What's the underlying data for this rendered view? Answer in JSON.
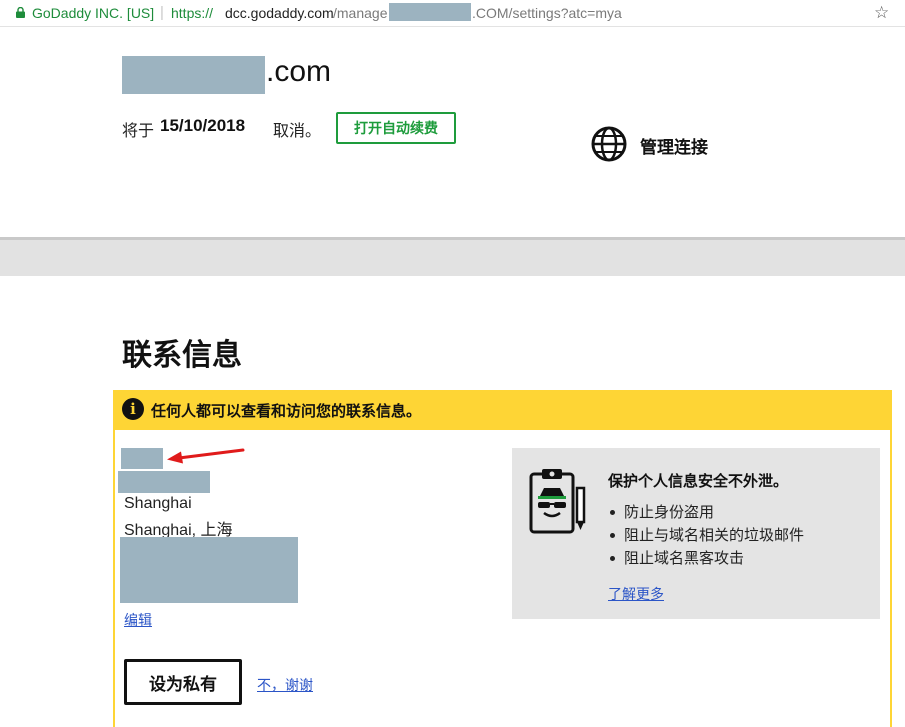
{
  "browser": {
    "secure_label": "GoDaddy INC. [US]",
    "separator": "|",
    "url_scheme": "https://",
    "url_host": "dcc.godaddy.com",
    "url_path_before": "/manage",
    "url_path_after": ".COM/settings?atc=mya",
    "bookmark_icon": "star-icon"
  },
  "domain": {
    "tld": ".com",
    "cancel_prefix": "将于",
    "cancel_date": "15/10/2018",
    "cancel_suffix": "取消。",
    "auto_renew_button": "打开自动续费",
    "manage_connection_label": "管理连接",
    "manage_icon": "globe-icon"
  },
  "contact": {
    "section_title": "联系信息",
    "warning_text": "任何人都可以查看和访问您的联系信息。",
    "city": "Shanghai",
    "city_region": "Shanghai, 上海",
    "edit_link": "编辑",
    "set_private_button": "设为私有",
    "no_thanks_link": "不，谢谢"
  },
  "privacy_promo": {
    "title": "保护个人信息安全不外泄。",
    "items": [
      "防止身份盗用",
      "阻止与域名相关的垃圾邮件",
      "阻止域名黑客攻击"
    ],
    "learn_more_link": "了解更多",
    "icon": "clipboard-spy-icon"
  },
  "colors": {
    "accent_green": "#1e9c3c",
    "warning_yellow": "#fed535",
    "link_blue": "#2b55c7",
    "redaction": "#9cb3c0"
  }
}
